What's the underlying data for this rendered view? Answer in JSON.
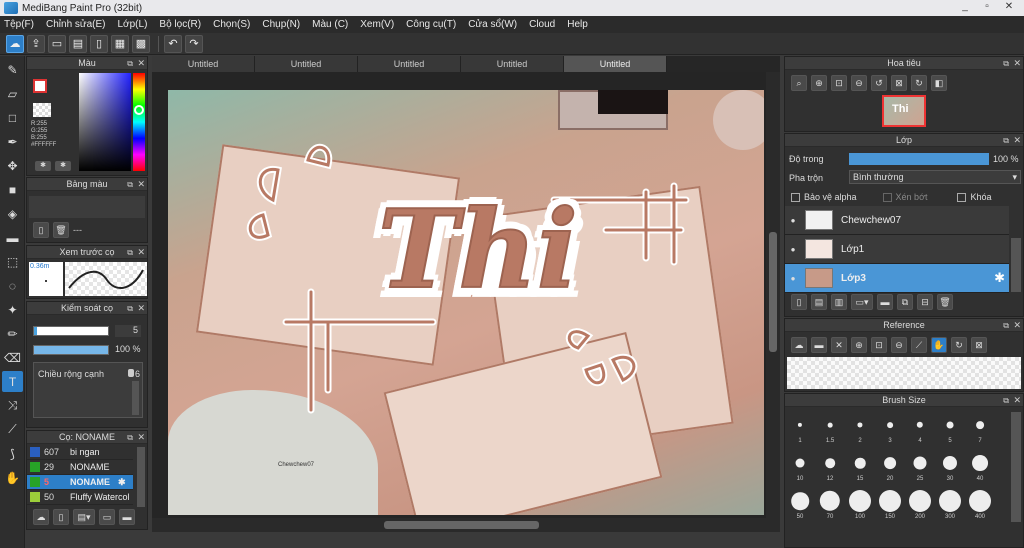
{
  "app": {
    "title": "MediBang Paint Pro (32bit)"
  },
  "window_buttons": [
    "_",
    "▫",
    "✕"
  ],
  "menu": [
    "Tệp(F)",
    "Chỉnh sửa(E)",
    "Lớp(L)",
    "Bộ lọc(R)",
    "Chọn(S)",
    "Chụp(N)",
    "Màu (C)",
    "Xem(V)",
    "Công cụ(T)",
    "Cửa sổ(W)",
    "Cloud",
    "Help"
  ],
  "tabs": [
    "Untitled",
    "Untitled",
    "Untitled",
    "Untitled",
    "Untitled"
  ],
  "color_panel": {
    "title": "Màu",
    "r": "R:255",
    "g": "G:255",
    "b": "B:255",
    "hex": "#FFFFFF"
  },
  "palette_panel": {
    "title": "Bảng màu",
    "dash": "---"
  },
  "preview_panel": {
    "title": "Xem trước cọ",
    "size": "0.36m"
  },
  "brush_control": {
    "title": "Kiểm soát cọ",
    "size_value": "5",
    "opacity_value": "100 %",
    "width_label": "Chiều rộng cạnh",
    "width_value": "6"
  },
  "brush_list": {
    "title": "Cọ: NONAME",
    "items": [
      {
        "num": "607",
        "name": "bi ngan",
        "color": "#2a5fc0"
      },
      {
        "num": "29",
        "name": "NONAME",
        "color": "#27a327"
      },
      {
        "num": "5",
        "name": "NONAME",
        "color": "#27a327"
      },
      {
        "num": "50",
        "name": "Fluffy Watercol",
        "color": "#9ccf3a"
      }
    ]
  },
  "navigator": {
    "title": "Hoa tiêu"
  },
  "layer_panel": {
    "title": "Lớp",
    "opacity_label": "Độ trong",
    "opacity_value": "100 %",
    "opacity": 1.0,
    "blend_label": "Pha trộn",
    "blend_value": "Bình thường",
    "protect_alpha": "Bảo vệ alpha",
    "clipping": "Xén bớt",
    "lock": "Khóa",
    "layers": [
      "Chewchew07",
      "Lớp1",
      "Lớp3"
    ],
    "selected_layer": "Lớp3"
  },
  "reference": {
    "title": "Reference"
  },
  "brush_size": {
    "title": "Brush Size",
    "sizes": [
      "1",
      "1.5",
      "2",
      "3",
      "4",
      "5",
      "7",
      "10",
      "12",
      "15",
      "20",
      "25",
      "30",
      "40",
      "50",
      "70",
      "100",
      "150",
      "200",
      "300",
      "400"
    ]
  },
  "artwork": {
    "headline": "Thi",
    "signature": "Chewchew07"
  },
  "colors": {
    "accent": "#2d7fc8",
    "text_brown": "#b87964",
    "outline": "#ffffff"
  }
}
